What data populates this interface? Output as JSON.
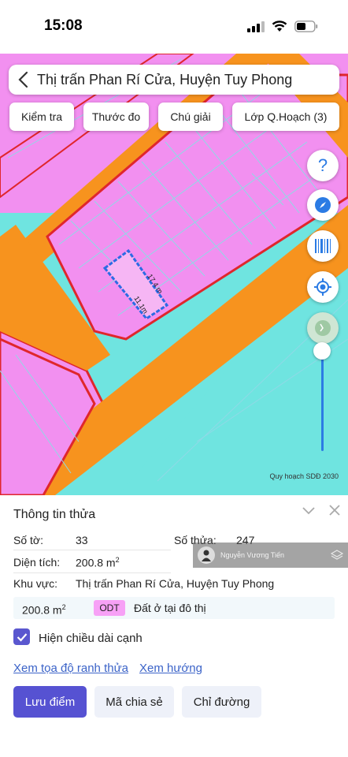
{
  "status_bar": {
    "time": "15:08"
  },
  "search": {
    "location": "Thị trấn Phan Rí Cửa, Huyện Tuy Phong"
  },
  "toolbar": {
    "check_label": "Kiểm tra",
    "measure_label": "Thước đo",
    "legend_label": "Chú giải",
    "layer_label": "Lớp Q.Hoạch (3)"
  },
  "map": {
    "edge_long": "17.4 m",
    "edge_short": "11.1m",
    "scale_label": "Quy hoạch SDĐ 2030",
    "colors": {
      "residential": "#f290f0",
      "road": "#f7931e",
      "water": "#6fe4e0"
    }
  },
  "panel": {
    "title": "Thông tin thửa",
    "sheet_label": "Số tờ:",
    "sheet_value": "33",
    "parcel_label": "Số thửa:",
    "parcel_value": "247",
    "area_label": "Diện tích:",
    "area_value": "200.8 m",
    "area_unit_sup": "2",
    "region_label": "Khu vực:",
    "region_value": "Thị trấn Phan Rí Cửa, Huyện Tuy Phong",
    "landuse": {
      "area": "200.8 m",
      "area_sup": "2",
      "code": "ODT",
      "description": "Đất ở tại đô thị"
    },
    "show_edges_label": "Hiện chiều dài cạnh",
    "show_edges_checked": true,
    "link_coords": "Xem tọa độ ranh thửa",
    "link_direction": "Xem hướng",
    "btn_save": "Lưu điểm",
    "btn_share": "Mã chia sẻ",
    "btn_route": "Chỉ đường"
  },
  "watermark": {
    "name": "Nguyễn Vương Tiến"
  }
}
